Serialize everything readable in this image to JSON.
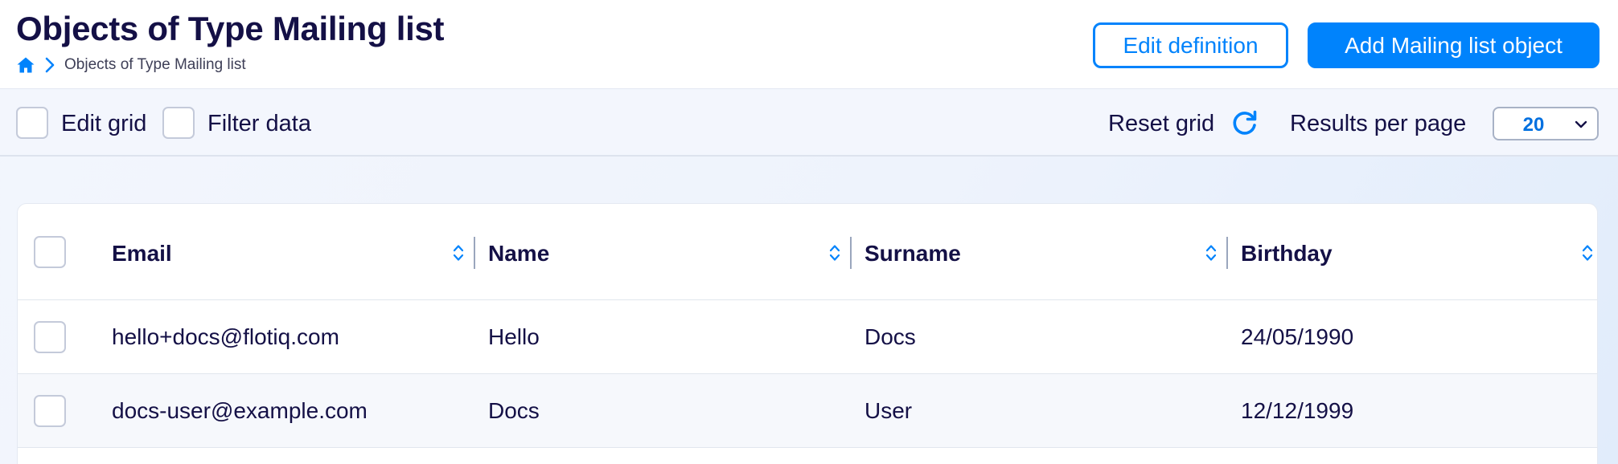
{
  "header": {
    "title": "Objects of Type Mailing list",
    "breadcrumb": {
      "home_icon": "home-icon",
      "current": "Objects of Type Mailing list"
    },
    "edit_definition_label": "Edit definition",
    "add_object_label": "Add Mailing list object"
  },
  "toolbar": {
    "edit_grid_label": "Edit grid",
    "filter_data_label": "Filter data",
    "reset_grid_label": "Reset grid",
    "results_per_page_label": "Results per page",
    "results_per_page_value": "20"
  },
  "table": {
    "columns": [
      "Email",
      "Name",
      "Surname",
      "Birthday"
    ],
    "rows": [
      {
        "email": "hello+docs@flotiq.com",
        "name": "Hello",
        "surname": "Docs",
        "birthday": "24/05/1990"
      },
      {
        "email": "docs-user@example.com",
        "name": "Docs",
        "surname": "User",
        "birthday": "12/12/1999"
      }
    ]
  },
  "colors": {
    "accent": "#0083fc",
    "text": "#141046",
    "toolbar_bg": "#f3f6fd"
  }
}
